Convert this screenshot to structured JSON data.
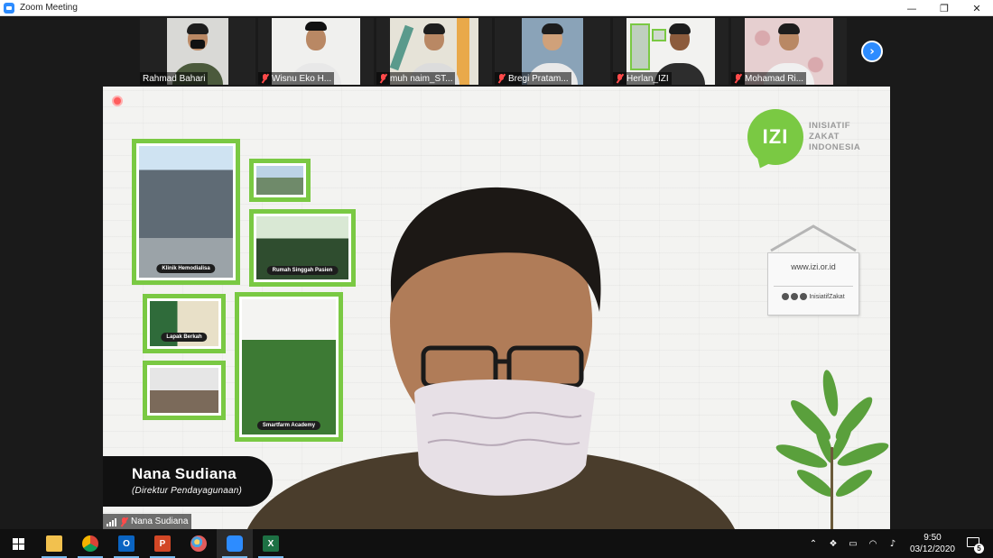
{
  "window": {
    "title": "Zoom Meeting",
    "controls": {
      "minimize": "—",
      "maximize": "❐",
      "close": "✕"
    }
  },
  "thumbnails": [
    {
      "name": "Rahmad Bahari",
      "muted": false
    },
    {
      "name": "Wisnu Eko H...",
      "muted": true
    },
    {
      "name": "muh naim_ST...",
      "muted": true
    },
    {
      "name": "Bregi Pratam...",
      "muted": true
    },
    {
      "name": "Herlan_IZI",
      "muted": true
    },
    {
      "name": "Mohamad Ri...",
      "muted": true
    }
  ],
  "next_page_label": "›",
  "main_speaker": {
    "banner_name": "Nana Sudiana",
    "banner_role": "(Direktur Pendayagunaan)",
    "video_label": "Nana Sudiana"
  },
  "background": {
    "logo_letters": "IZI",
    "logo_line1": "INISIATIF",
    "logo_line2": "ZAKAT",
    "logo_line3": "INDONESIA",
    "sign_url": "www.izi.or.id",
    "sign_social": "InisiatifZakat",
    "photos": [
      {
        "caption": "Klinik Hemodialisa"
      },
      {
        "caption": "Rumah Singgah Pasien"
      },
      {
        "caption": "Lapak Berkah"
      },
      {
        "caption": "Smartfarm Academy"
      }
    ]
  },
  "taskbar": {
    "apps": [
      "start-menu",
      "file-explorer",
      "chrome",
      "outlook",
      "powerpoint",
      "paint",
      "zoom",
      "excel"
    ],
    "tray": {
      "time": "9:50",
      "date": "03/12/2020",
      "notification_count": "5"
    }
  },
  "colors": {
    "izi_green": "#7ac943",
    "zoom_blue": "#2d8cff",
    "muted_red": "#ff4a4a"
  }
}
